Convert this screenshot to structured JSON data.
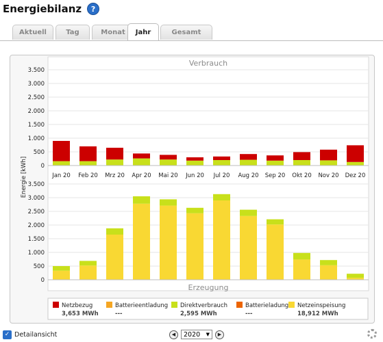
{
  "header": {
    "title": "Energiebilanz",
    "help_glyph": "?"
  },
  "tabs": [
    {
      "label": "Aktuell"
    },
    {
      "label": "Tag"
    },
    {
      "label": "Monat"
    },
    {
      "label": "Jahr"
    },
    {
      "label": "Gesamt"
    }
  ],
  "active_tab": "Jahr",
  "chart_data": [
    {
      "type": "bar",
      "title": "Verbrauch",
      "ylabel": "Energie [kWh]",
      "categories": [
        "Jan 20",
        "Feb 20",
        "Mrz 20",
        "Apr 20",
        "Mai 20",
        "Jun 20",
        "Jul 20",
        "Aug 20",
        "Sep 20",
        "Okt 20",
        "Nov 20",
        "Dez 20"
      ],
      "ylim": [
        0,
        3500
      ],
      "yticks": [
        "3.500",
        "3.000",
        "2.500",
        "2.000",
        "1.500",
        "1.000",
        "500",
        "0"
      ],
      "stacked": true,
      "series": [
        {
          "name": "Direktverbrauch",
          "color": "#c8e01b",
          "values": [
            160,
            160,
            220,
            260,
            220,
            180,
            200,
            210,
            180,
            200,
            190,
            130
          ]
        },
        {
          "name": "Netzbezug",
          "color": "#cc0000",
          "values": [
            740,
            540,
            430,
            180,
            170,
            120,
            130,
            210,
            190,
            290,
            390,
            610
          ]
        }
      ]
    },
    {
      "type": "bar",
      "title": "Erzeugung",
      "ylabel": "Energie [kWh]",
      "categories": [
        "Jan 20",
        "Feb 20",
        "Mrz 20",
        "Apr 20",
        "Mai 20",
        "Jun 20",
        "Jul 20",
        "Aug 20",
        "Sep 20",
        "Okt 20",
        "Nov 20",
        "Dez 20"
      ],
      "ylim": [
        0,
        3500
      ],
      "yticks": [
        "0",
        "500",
        "1.000",
        "1.500",
        "2.000",
        "2.500",
        "3.000",
        "3.500"
      ],
      "stacked": true,
      "series": [
        {
          "name": "Netzeinspeisung",
          "color": "#f9d833",
          "values": [
            330,
            520,
            1650,
            2780,
            2710,
            2430,
            2900,
            2330,
            2020,
            740,
            530,
            70
          ]
        },
        {
          "name": "Direktverbrauch",
          "color": "#c8e01b",
          "values": [
            170,
            170,
            230,
            270,
            230,
            200,
            230,
            230,
            190,
            240,
            190,
            150
          ]
        }
      ]
    }
  ],
  "legend": [
    {
      "name": "Netzbezug",
      "value": "3,653 MWh",
      "color": "#cc0000"
    },
    {
      "name": "Batterieentladung",
      "value": "---",
      "color": "#f5a623"
    },
    {
      "name": "Direktverbrauch",
      "value": "2,595 MWh",
      "color": "#c8e01b"
    },
    {
      "name": "Batterieladung",
      "value": "---",
      "color": "#ec6400"
    },
    {
      "name": "Netzeinspeisung",
      "value": "18,912 MWh",
      "color": "#f9d833"
    }
  ],
  "footer": {
    "detail_label": "Detailansicht",
    "detail_checked": true,
    "year": "2020",
    "prev_glyph": "◀",
    "next_glyph": "▶"
  }
}
